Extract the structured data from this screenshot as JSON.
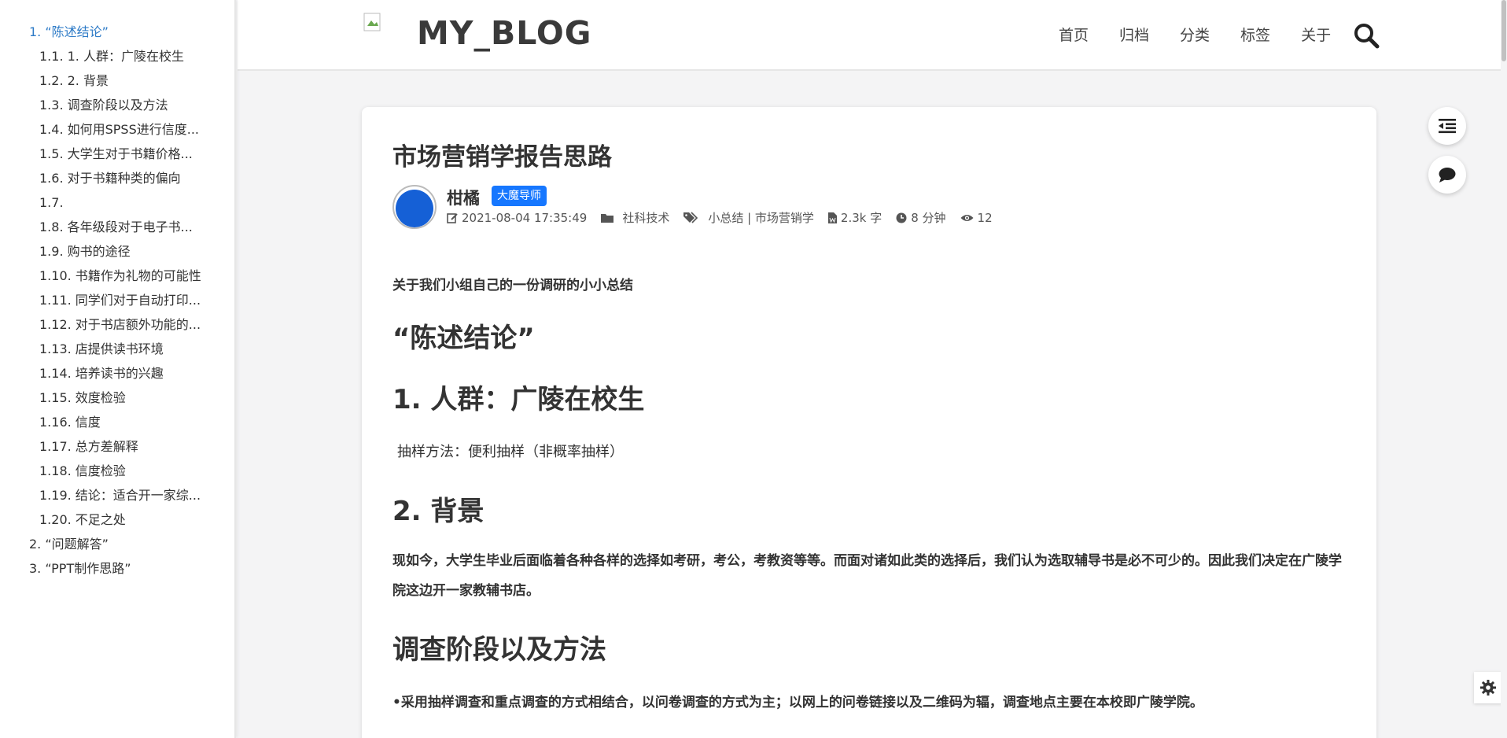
{
  "toc": {
    "items": [
      {
        "label": "1. “陈述结论”",
        "level": 1,
        "active": true
      },
      {
        "label": "1.1. 1. 人群：广陵在校生",
        "level": 2
      },
      {
        "label": "1.2. 2. 背景",
        "level": 2
      },
      {
        "label": "1.3. 调查阶段以及方法",
        "level": 2
      },
      {
        "label": "1.4. 如何用SPSS进行信度...",
        "level": 2
      },
      {
        "label": "1.5. 大学生对于书籍价格...",
        "level": 2
      },
      {
        "label": "1.6. 对于书籍种类的偏向",
        "level": 2
      },
      {
        "label": "1.7.",
        "level": 2
      },
      {
        "label": "1.8. 各年级段对于电子书...",
        "level": 2
      },
      {
        "label": "1.9. 购书的途径",
        "level": 2
      },
      {
        "label": "1.10. 书籍作为礼物的可能性",
        "level": 2
      },
      {
        "label": "1.11. 同学们对于自动打印...",
        "level": 2
      },
      {
        "label": "1.12. 对于书店额外功能的...",
        "level": 2
      },
      {
        "label": "1.13. 店提供读书环境",
        "level": 2
      },
      {
        "label": "1.14. 培养读书的兴趣",
        "level": 2
      },
      {
        "label": "1.15. 效度检验",
        "level": 2
      },
      {
        "label": "1.16. 信度",
        "level": 2
      },
      {
        "label": "1.17. 总方差解释",
        "level": 2
      },
      {
        "label": "1.18. 信度检验",
        "level": 2
      },
      {
        "label": "1.19. 结论：适合开一家综...",
        "level": 2
      },
      {
        "label": "1.20. 不足之处",
        "level": 2
      },
      {
        "label": "2. “问题解答”",
        "level": 1
      },
      {
        "label": "3. “PPT制作思路”",
        "level": 1
      }
    ]
  },
  "header": {
    "site_title": "MY_BLOG",
    "nav": [
      "首页",
      "归档",
      "分类",
      "标签",
      "关于"
    ],
    "search_icon": "search-icon"
  },
  "post": {
    "title": "市场营销学报告思路",
    "author": "柑橘",
    "badge": "大魔导师",
    "date": "2021-08-04 17:35:49",
    "category": "社科技术",
    "tags": "小总结 | 市场营销学",
    "word_count": "2.3k 字",
    "read_time": "8 分钟",
    "views": "12",
    "intro": "关于我们小组自己的一份调研的小小总结",
    "h_conclusion": "“陈述结论”",
    "h_crowd": "1. 人群：广陵在校生",
    "sampling": "抽样方法：便利抽样（非概率抽样）",
    "h_background": "2. 背景",
    "background_text": "现如今，大学生毕业后面临着各种各样的选择如考研，考公，考教资等等。而面对诸如此类的选择后，我们认为选取辅导书是必不可少的。因此我们决定在广陵学院这边开一家教辅书店。",
    "h_method": "调查阶段以及方法",
    "method_text": "•采用抽样调查和重点调查的方式相结合，以问卷调查的方式为主；以网上的问卷链接以及二维码为辐，调查地点主要在本校即广陵学院。"
  },
  "colors": {
    "accent": "#2e7bc7",
    "badge": "#1677ff"
  }
}
